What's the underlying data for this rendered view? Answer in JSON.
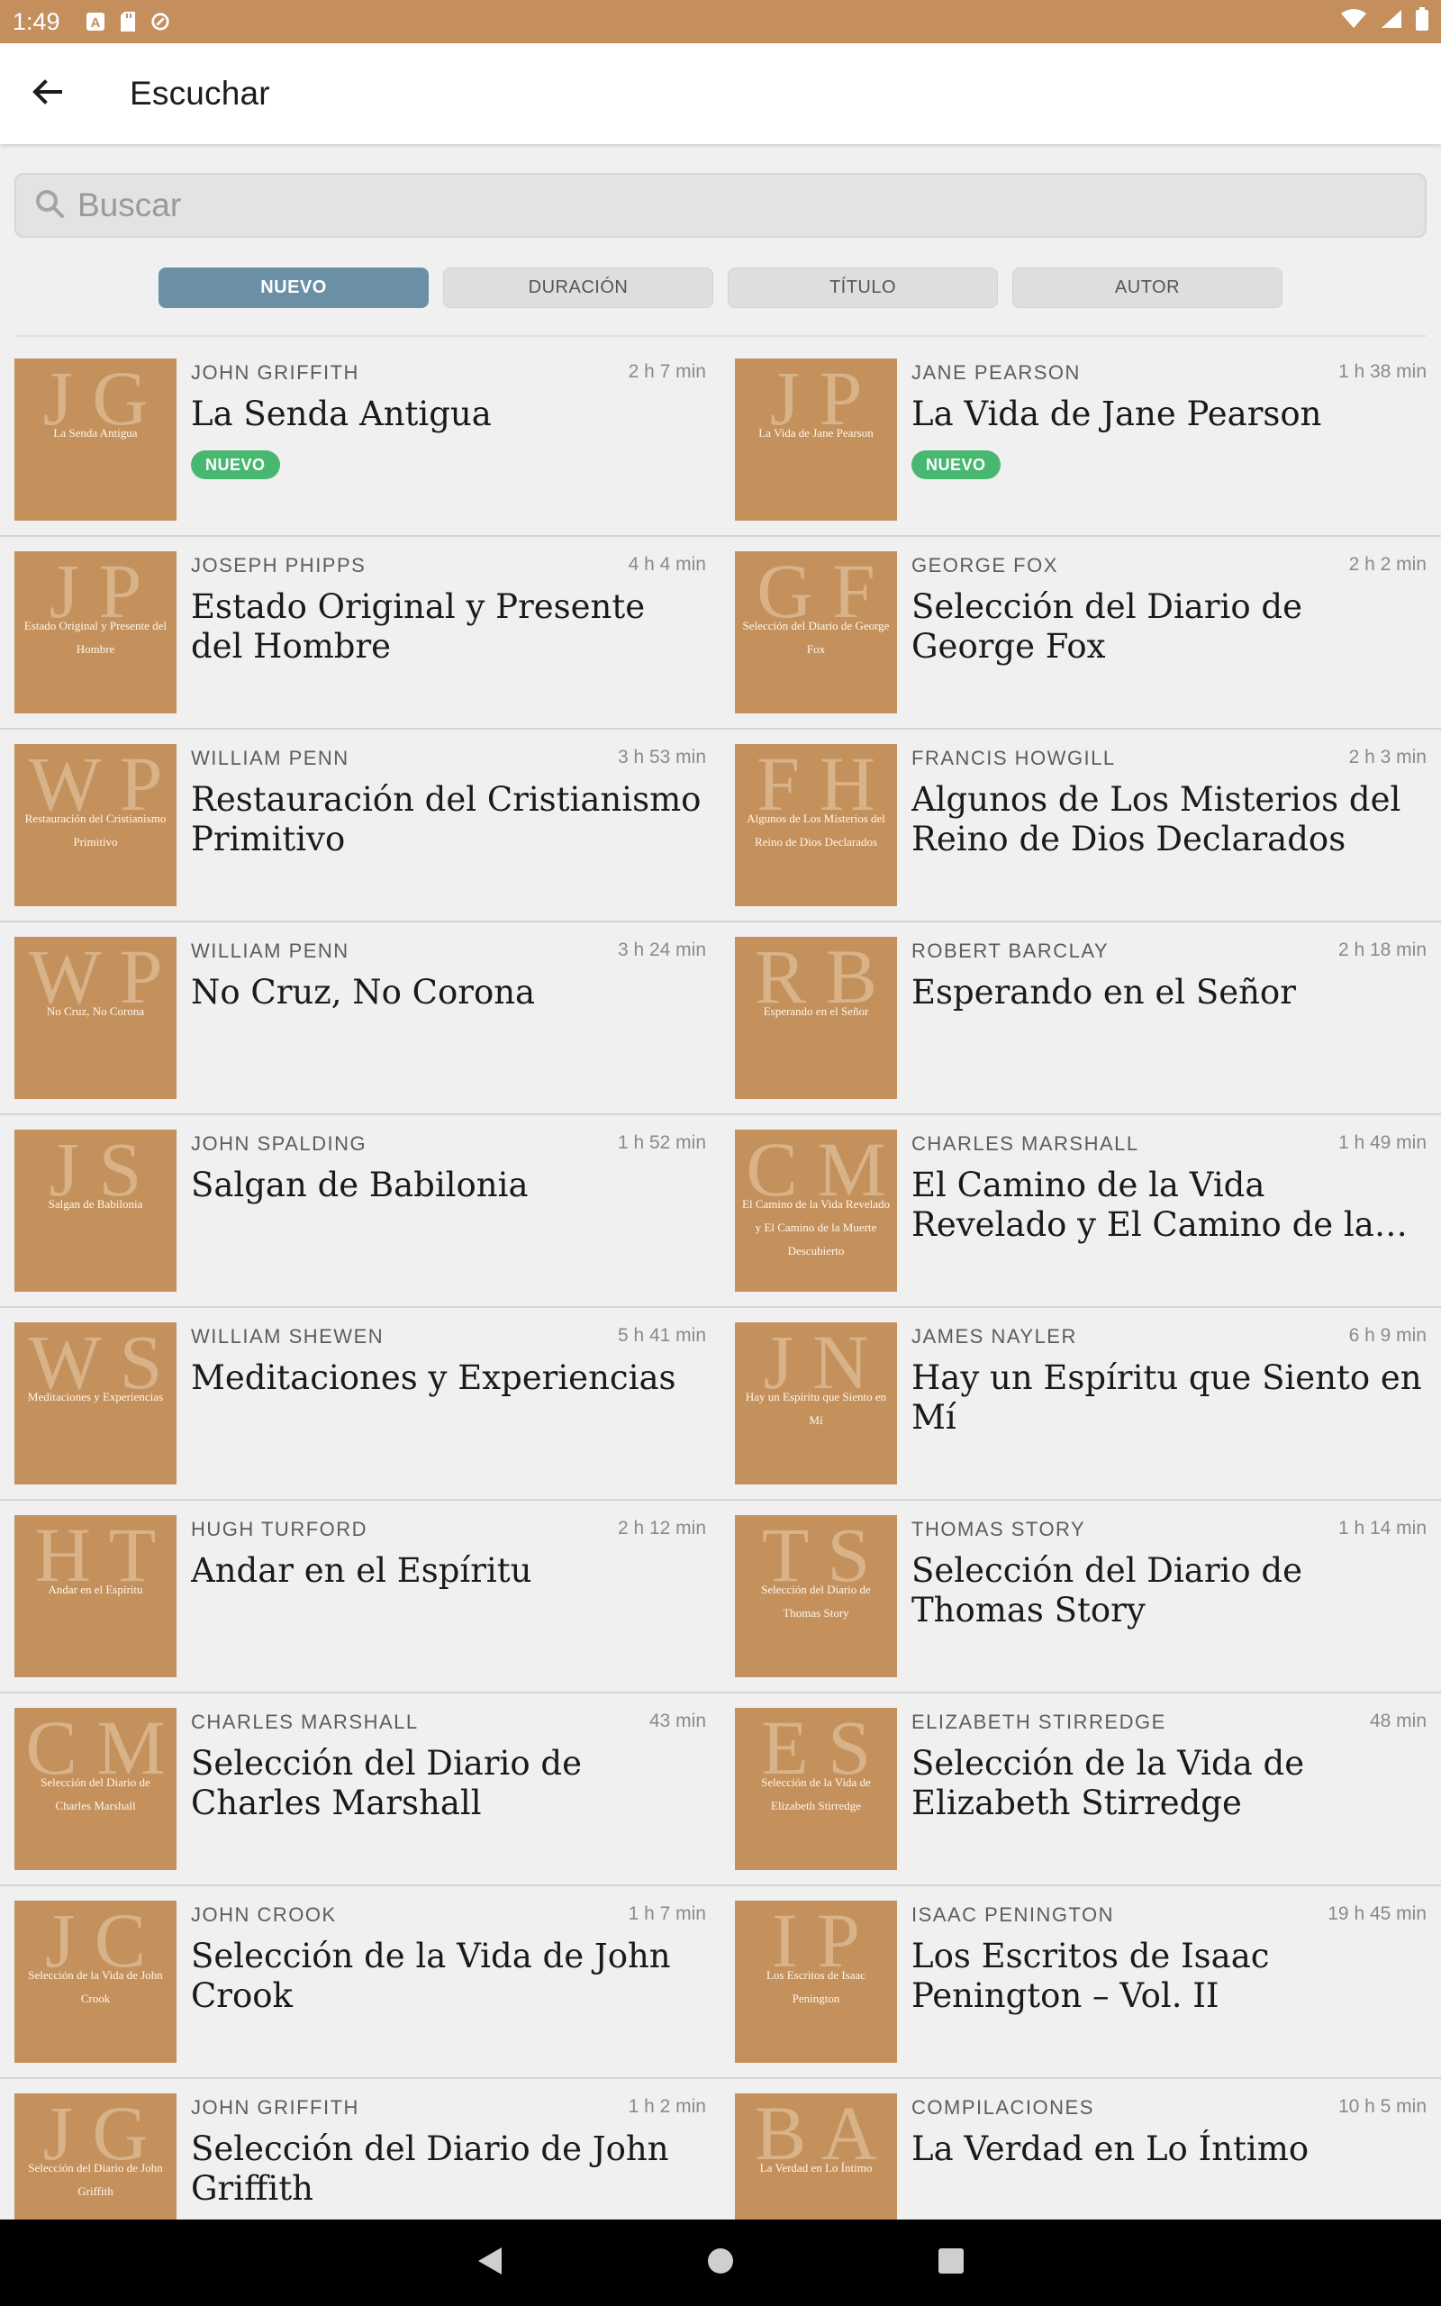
{
  "status_bar": {
    "time": "1:49",
    "icons": [
      "notification-a-icon",
      "sd-card-icon",
      "sync-icon"
    ],
    "right_icons": [
      "wifi-icon",
      "signal-icon",
      "battery-icon"
    ]
  },
  "app_bar": {
    "title": "Escuchar"
  },
  "search": {
    "placeholder": "Buscar",
    "value": ""
  },
  "tabs": [
    {
      "label": "NUEVO",
      "active": true
    },
    {
      "label": "DURACIÓN",
      "active": false
    },
    {
      "label": "TÍTULO",
      "active": false
    },
    {
      "label": "AUTOR",
      "active": false
    }
  ],
  "badge_label": "NUEVO",
  "books": [
    {
      "author": "JOHN GRIFFITH",
      "duration": "2 h 7 min",
      "title": "La Senda Antigua",
      "new": true,
      "cover_mono": "J G",
      "cover_title": "La Senda Antigua"
    },
    {
      "author": "JANE PEARSON",
      "duration": "1 h 38 min",
      "title": "La Vida de Jane Pearson",
      "new": true,
      "cover_mono": "J P",
      "cover_title": "La Vida de Jane Pearson"
    },
    {
      "author": "JOSEPH PHIPPS",
      "duration": "4 h 4 min",
      "title": "Estado Original y Presente del Hombre",
      "new": false,
      "cover_mono": "J P",
      "cover_title": "Estado Original y Presente del Hombre"
    },
    {
      "author": "GEORGE FOX",
      "duration": "2 h 2 min",
      "title": "Selección del Diario de George Fox",
      "new": false,
      "cover_mono": "G F",
      "cover_title": "Selección del Diario de George Fox"
    },
    {
      "author": "WILLIAM PENN",
      "duration": "3 h 53 min",
      "title": "Restauración del Cristianismo Primitivo",
      "new": false,
      "cover_mono": "W P",
      "cover_title": "Restauración del Cristianismo Primitivo"
    },
    {
      "author": "FRANCIS HOWGILL",
      "duration": "2 h 3 min",
      "title": "Algunos de Los Misterios del Reino de Dios Declarados",
      "new": false,
      "cover_mono": "F H",
      "cover_title": "Algunos de Los Misterios del Reino de Dios Declarados"
    },
    {
      "author": "WILLIAM PENN",
      "duration": "3 h 24 min",
      "title": "No Cruz, No Corona",
      "new": false,
      "cover_mono": "W P",
      "cover_title": "No Cruz, No Corona"
    },
    {
      "author": "ROBERT BARCLAY",
      "duration": "2 h 18 min",
      "title": "Esperando en el Señor",
      "new": false,
      "cover_mono": "R B",
      "cover_title": "Esperando en el Señor"
    },
    {
      "author": "JOHN SPALDING",
      "duration": "1 h 52 min",
      "title": "Salgan de Babilonia",
      "new": false,
      "cover_mono": "J S",
      "cover_title": "Salgan de Babilonia"
    },
    {
      "author": "CHARLES MARSHALL",
      "duration": "1 h 49 min",
      "title": "El Camino de la Vida Revelado y El Camino de la Muerte Desc..",
      "new": false,
      "cover_mono": "C M",
      "cover_title": "El Camino de la Vida Revelado y El Camino de la Muerte Descubierto"
    },
    {
      "author": "WILLIAM SHEWEN",
      "duration": "5 h 41 min",
      "title": "Meditaciones y Experiencias",
      "new": false,
      "cover_mono": "W S",
      "cover_title": "Meditaciones y Experiencias"
    },
    {
      "author": "JAMES NAYLER",
      "duration": "6 h 9 min",
      "title": "Hay un Espíritu que Siento en Mí",
      "new": false,
      "cover_mono": "J N",
      "cover_title": "Hay un Espíritu que Siento en Mí"
    },
    {
      "author": "HUGH TURFORD",
      "duration": "2 h 12 min",
      "title": "Andar en el Espíritu",
      "new": false,
      "cover_mono": "H T",
      "cover_title": "Andar en el Espíritu"
    },
    {
      "author": "THOMAS STORY",
      "duration": "1 h 14 min",
      "title": "Selección del Diario de Thomas Story",
      "new": false,
      "cover_mono": "T S",
      "cover_title": "Selección del Diario de Thomas Story"
    },
    {
      "author": "CHARLES MARSHALL",
      "duration": "43 min",
      "title": "Selección del Diario de Charles Marshall",
      "new": false,
      "cover_mono": "C M",
      "cover_title": "Selección del Diario de Charles Marshall"
    },
    {
      "author": "ELIZABETH STIRREDGE",
      "duration": "48 min",
      "title": "Selección de la Vida de Elizabeth Stirredge",
      "new": false,
      "cover_mono": "E S",
      "cover_title": "Selección de la Vida de Elizabeth Stirredge"
    },
    {
      "author": "JOHN CROOK",
      "duration": "1 h 7 min",
      "title": "Selección de la Vida de John Crook",
      "new": false,
      "cover_mono": "J C",
      "cover_title": "Selección de la Vida de John Crook"
    },
    {
      "author": "ISAAC PENINGTON",
      "duration": "19 h 45 min",
      "title": "Los Escritos de Isaac Penington – Vol. II",
      "new": false,
      "cover_mono": "I P",
      "cover_title": "Los Escritos de Isaac Penington"
    },
    {
      "author": "JOHN GRIFFITH",
      "duration": "1 h 2 min",
      "title": "Selección del Diario de John Griffith",
      "new": false,
      "cover_mono": "J G",
      "cover_title": "Selección del Diario de John Griffith"
    },
    {
      "author": "COMPILACIONES",
      "duration": "10 h 5 min",
      "title": "La Verdad en Lo Íntimo",
      "new": false,
      "cover_mono": "B A",
      "cover_title": "La Verdad en Lo Íntimo"
    }
  ],
  "colors": {
    "accent": "#c48f5c",
    "cover": "#c4915d",
    "tab_active": "#6b90a6",
    "badge": "#48b870"
  },
  "nav_bar": {
    "buttons": [
      "back-triangle-icon",
      "home-circle-icon",
      "recents-square-icon"
    ]
  }
}
